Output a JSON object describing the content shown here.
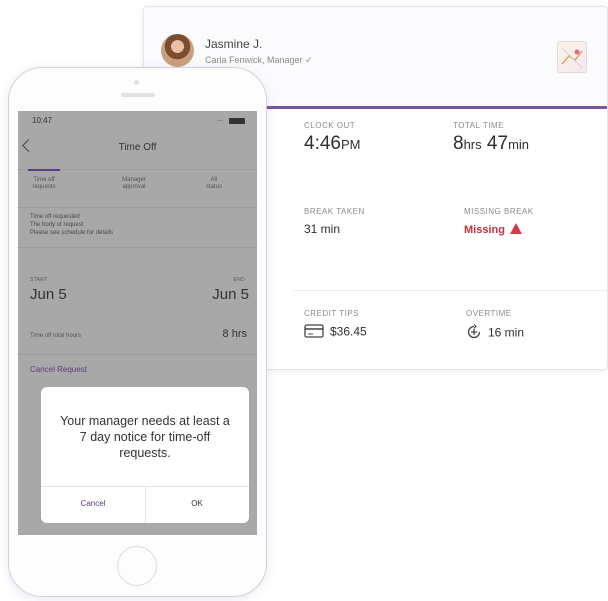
{
  "card": {
    "user_name": "Jasmine J.",
    "user_subtitle": "Carla Fenwick, Manager ✓",
    "clock_out": {
      "label": "CLOCK OUT",
      "time": "4:46",
      "suffix": "PM"
    },
    "total_time": {
      "label": "TOTAL TIME",
      "hours": "8",
      "hours_unit": "hrs",
      "minutes": "47",
      "minutes_unit": "min"
    },
    "break_taken": {
      "label": "BREAK TAKEN",
      "value": "31 min"
    },
    "missing_break": {
      "label": "MISSING BREAK",
      "value": "Missing"
    },
    "credit_tips": {
      "label": "CREDIT TIPS",
      "value": "$36.45"
    },
    "overtime": {
      "label": "OVERTIME",
      "value": "16 min"
    }
  },
  "phone": {
    "status_time": "10:47",
    "status_signal": "...",
    "nav_title": "Time Off",
    "tabs": [
      {
        "line1": "Time off",
        "line2": "requests"
      },
      {
        "line1": "Manager",
        "line2": "approval"
      },
      {
        "line1": "All",
        "line2": "status"
      }
    ],
    "info_lines": [
      "Time off requested",
      "The body of request",
      "Please see schedule for details"
    ],
    "start_label": "START",
    "start_date": "Jun 5",
    "end_label": "END",
    "end_date": "Jun 5",
    "hours_label": "Time off total hours",
    "hours_value": "8 hrs",
    "cancel_request": "Cancel Request",
    "dialog": {
      "message": "Your manager needs at least a 7 day notice for time-off requests.",
      "cancel": "Cancel",
      "ok": "OK"
    }
  }
}
